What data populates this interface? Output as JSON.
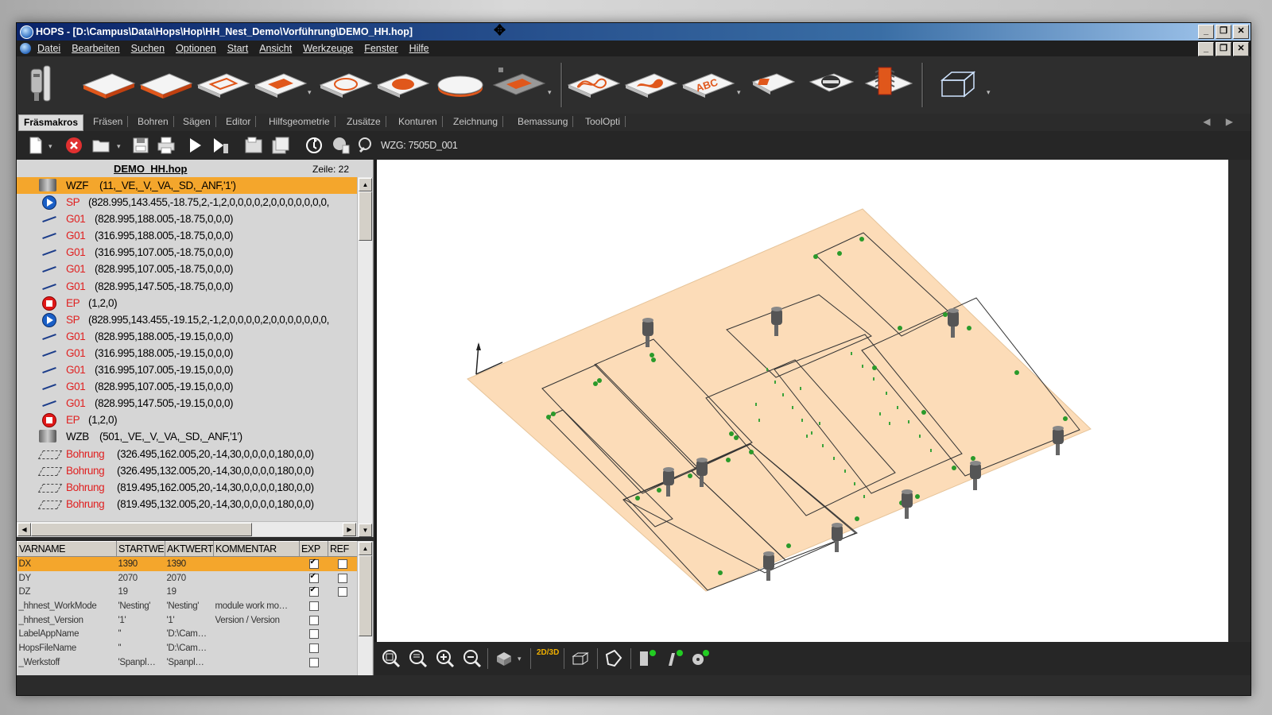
{
  "window": {
    "title": "HOPS - [D:\\Campus\\Data\\Hops\\Hop\\HH_Nest_Demo\\Vorführung\\DEMO_HH.hop]",
    "buttons": [
      "_",
      "❐",
      "✕"
    ]
  },
  "menu": [
    "Datei",
    "Bearbeiten",
    "Suchen",
    "Optionen",
    "Start",
    "Ansicht",
    "Werkzeuge",
    "Fenster",
    "Hilfe"
  ],
  "tabs": [
    "Fräsmakros",
    "Fräsen",
    "Bohren",
    "Sägen",
    "Editor",
    "Hilfsgeometrie",
    "Zusätze",
    "Konturen",
    "Zeichnung",
    "Bemassung",
    "ToolOpti"
  ],
  "tabs_nav": "◀ ▶",
  "toolbar": {
    "wzg_label": "WZG: 7505D_001"
  },
  "program": {
    "file_name": "DEMO_HH.hop",
    "zeile": "Zeile: 22",
    "rows": [
      {
        "icon": "tool-change-icon",
        "kw": "WZF",
        "args": "(11,_VE,_V,_VA,_SD,_ANF,'1')",
        "selected": true
      },
      {
        "icon": "start-point-icon",
        "kw": "SP",
        "args": "(828.995,143.455,-18.75,2,-1,2,0,0,0,0,2,0,0,0,0,0,0,0,"
      },
      {
        "icon": "line-icon",
        "kw": "G01",
        "args": "(828.995,188.005,-18.75,0,0,0)"
      },
      {
        "icon": "line-icon",
        "kw": "G01",
        "args": "(316.995,188.005,-18.75,0,0,0)"
      },
      {
        "icon": "line-icon",
        "kw": "G01",
        "args": "(316.995,107.005,-18.75,0,0,0)"
      },
      {
        "icon": "line-icon",
        "kw": "G01",
        "args": "(828.995,107.005,-18.75,0,0,0)"
      },
      {
        "icon": "line-icon",
        "kw": "G01",
        "args": "(828.995,147.505,-18.75,0,0,0)"
      },
      {
        "icon": "end-point-icon",
        "kw": "EP",
        "args": "(1,2,0)"
      },
      {
        "icon": "start-point-icon",
        "kw": "SP",
        "args": "(828.995,143.455,-19.15,2,-1,2,0,0,0,0,2,0,0,0,0,0,0,0,"
      },
      {
        "icon": "line-icon",
        "kw": "G01",
        "args": "(828.995,188.005,-19.15,0,0,0)"
      },
      {
        "icon": "line-icon",
        "kw": "G01",
        "args": "(316.995,188.005,-19.15,0,0,0)"
      },
      {
        "icon": "line-icon",
        "kw": "G01",
        "args": "(316.995,107.005,-19.15,0,0,0)"
      },
      {
        "icon": "line-icon",
        "kw": "G01",
        "args": "(828.995,107.005,-19.15,0,0,0)"
      },
      {
        "icon": "line-icon",
        "kw": "G01",
        "args": "(828.995,147.505,-19.15,0,0,0)"
      },
      {
        "icon": "end-point-icon",
        "kw": "EP",
        "args": "(1,2,0)"
      },
      {
        "icon": "tool-change-icon",
        "kw": "WZB",
        "args": "(501,_VE,_V,_VA,_SD,_ANF,'1')",
        "kw_black": true
      },
      {
        "icon": "drilling-icon",
        "kw": "Bohrung",
        "args": "(326.495,162.005,20,-14,30,0,0,0,0,180,0,0)"
      },
      {
        "icon": "drilling-icon",
        "kw": "Bohrung",
        "args": "(326.495,132.005,20,-14,30,0,0,0,0,180,0,0)"
      },
      {
        "icon": "drilling-icon",
        "kw": "Bohrung",
        "args": "(819.495,162.005,20,-14,30,0,0,0,0,180,0,0)"
      },
      {
        "icon": "drilling-icon",
        "kw": "Bohrung",
        "args": "(819.495,132.005,20,-14,30,0,0,0,0,180,0,0)"
      }
    ]
  },
  "variables": {
    "columns": [
      "VARNAME",
      "STARTWE",
      "AKTWERT",
      "KOMMENTAR",
      "EXP",
      "REF"
    ],
    "rows": [
      {
        "name": "DX",
        "start": "1390",
        "akt": "1390",
        "komm": "",
        "exp": true,
        "ref": false,
        "selected": true
      },
      {
        "name": "DY",
        "start": "2070",
        "akt": "2070",
        "komm": "",
        "exp": true,
        "ref": false
      },
      {
        "name": "DZ",
        "start": "19",
        "akt": "19",
        "komm": "",
        "exp": true,
        "ref": false
      },
      {
        "name": "_hhnest_WorkMode",
        "start": "'Nesting'",
        "akt": "'Nesting'",
        "komm": "module work mo…",
        "exp": false
      },
      {
        "name": "_hhnest_Version",
        "start": "'1'",
        "akt": "'1'",
        "komm": "Version / Version",
        "exp": false
      },
      {
        "name": "LabelAppName",
        "start": "''",
        "akt": "'D:\\Cam…",
        "komm": "",
        "exp": false
      },
      {
        "name": "HopsFileName",
        "start": "''",
        "akt": "'D:\\Cam…",
        "komm": "",
        "exp": false
      },
      {
        "name": "_Werkstoff",
        "start": "'Spanpl…",
        "akt": "'Spanpl…",
        "komm": "",
        "exp": false
      }
    ]
  },
  "bottom_toolbar": {
    "view_toggle": "2D/3D"
  },
  "colors": {
    "selection": "#f4a62c",
    "panel": "#d8c0a0",
    "keyword": "#e02020",
    "accent_orange": "#e0571b"
  }
}
